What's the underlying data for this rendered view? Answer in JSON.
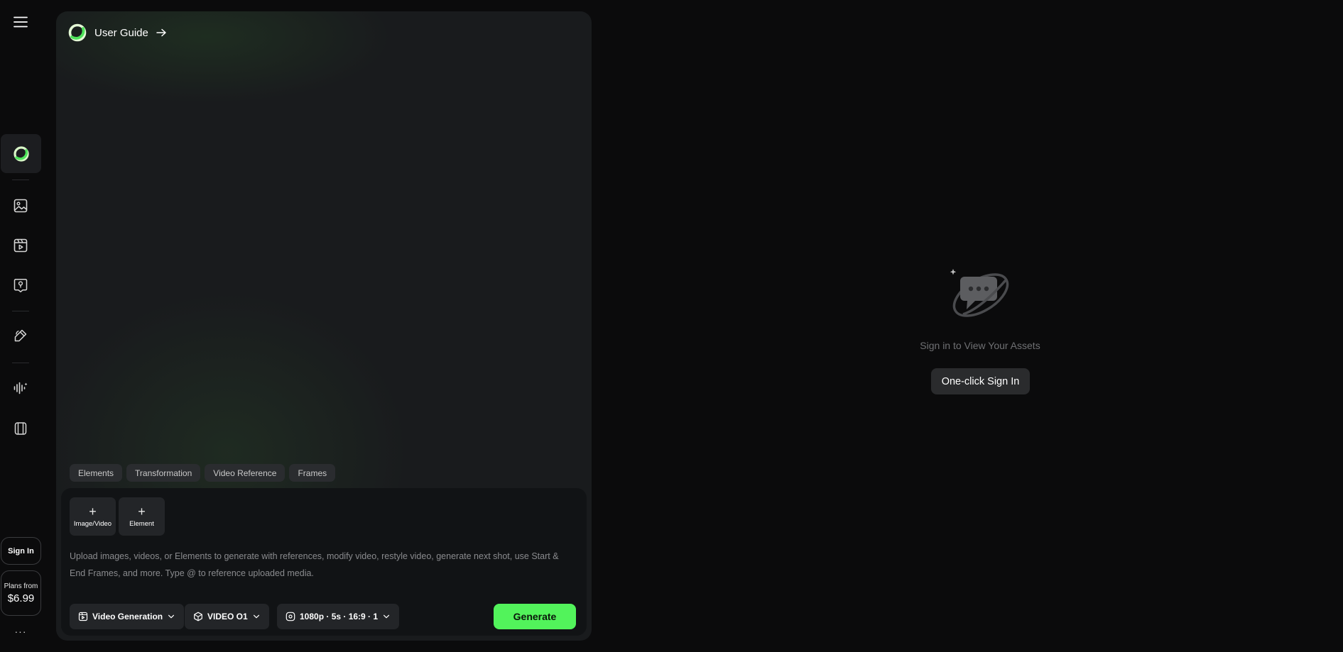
{
  "sidebar": {
    "items": [
      {
        "icon": "home-logo-icon"
      },
      {
        "icon": "image-icon"
      },
      {
        "icon": "video-icon"
      },
      {
        "icon": "avatar-icon"
      },
      {
        "icon": "edit-icon"
      },
      {
        "icon": "audio-icon"
      },
      {
        "icon": "assets-icon"
      }
    ],
    "signin_label": "Sign In",
    "plans_label": "Plans from",
    "plans_price": "$6.99",
    "more_label": "···"
  },
  "panel": {
    "user_guide_label": "User Guide",
    "mode_tabs": [
      "Elements",
      "Transformation",
      "Video Reference",
      "Frames"
    ],
    "upload_image_video_label": "Image/Video",
    "upload_element_label": "Element",
    "prompt_placeholder": "Upload images, videos, or Elements to generate with references, modify video, restyle video, generate next shot, use Start & End Frames, and more. Type @ to reference uploaded media.",
    "controls": {
      "mode_label": "Video Generation",
      "model_label": "VIDEO O1",
      "settings_label": "1080p · 5s · 16:9 · 1"
    },
    "generate_label": "Generate"
  },
  "assets": {
    "empty_message": "Sign in to View Your Assets",
    "signin_button_label": "One-click Sign In"
  },
  "colors": {
    "accent": "#52f35b",
    "background": "#0b0b0c",
    "panel": "#191b1d"
  }
}
